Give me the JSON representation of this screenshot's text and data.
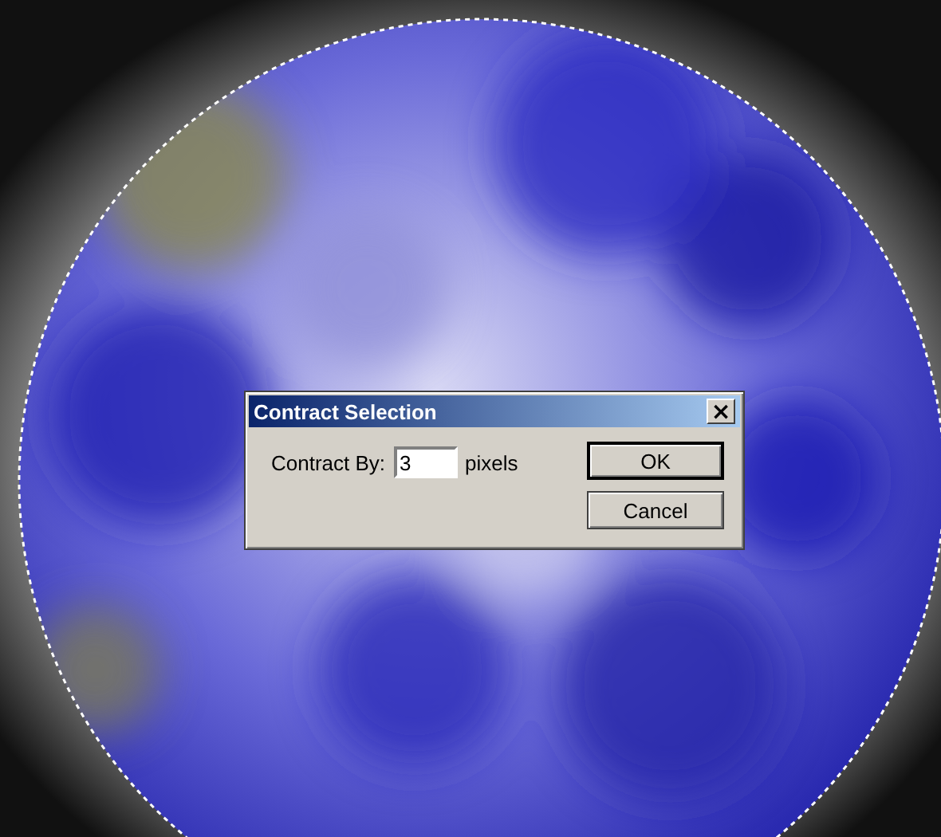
{
  "dialog": {
    "title": "Contract Selection",
    "close_glyph": "×",
    "field": {
      "label": "Contract By:",
      "value": "3",
      "unit": "pixels"
    },
    "buttons": [
      {
        "label": "OK",
        "default": true
      },
      {
        "label": "Cancel",
        "default": false
      }
    ]
  }
}
